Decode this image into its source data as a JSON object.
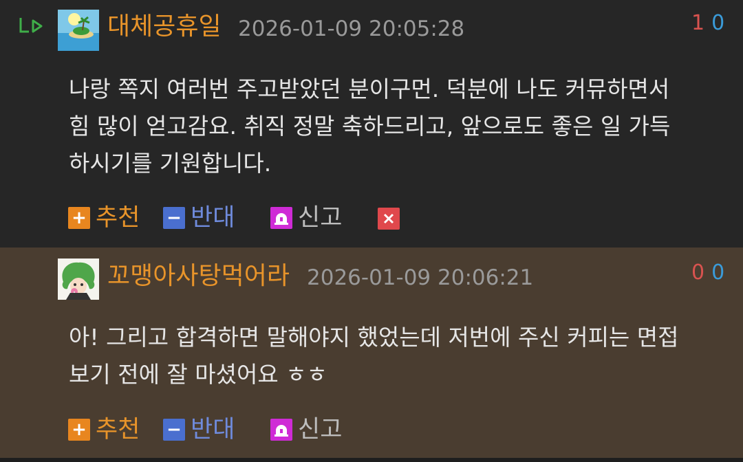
{
  "comments": [
    {
      "username": "대체공휴일",
      "timestamp": "2026-01-09 20:05:28",
      "votes": {
        "up": "1",
        "down": "0"
      },
      "lines": [
        "나랑 쪽지 여러번 주고받았던 분이구먼. 덕분에 나도 커뮤하면서",
        "힘 많이 얻고감요. 취직 정말 축하드리고, 앞으로도 좋은 일 가득",
        "하시기를 기원합니다."
      ],
      "actions": {
        "recommend": "추천",
        "oppose": "반대",
        "report": "신고",
        "delete_icon": "x-icon"
      }
    },
    {
      "username": "꼬맹아사탕먹어라",
      "timestamp": "2026-01-09 20:06:21",
      "votes": {
        "up": "0",
        "down": "0"
      },
      "lines": [
        "아! 그리고 합격하면 말해야지 했었는데 저번에 주신 커피는 면접",
        "보기 전에 잘 마셨어요 ㅎㅎ"
      ],
      "actions": {
        "recommend": "추천",
        "oppose": "반대",
        "report": "신고"
      }
    }
  ],
  "colors": {
    "username": "#e8942a",
    "vote_up": "#d9534f",
    "vote_down": "#3a9bd9",
    "reply_bg": "#4a3d30",
    "page_bg": "#262626"
  }
}
